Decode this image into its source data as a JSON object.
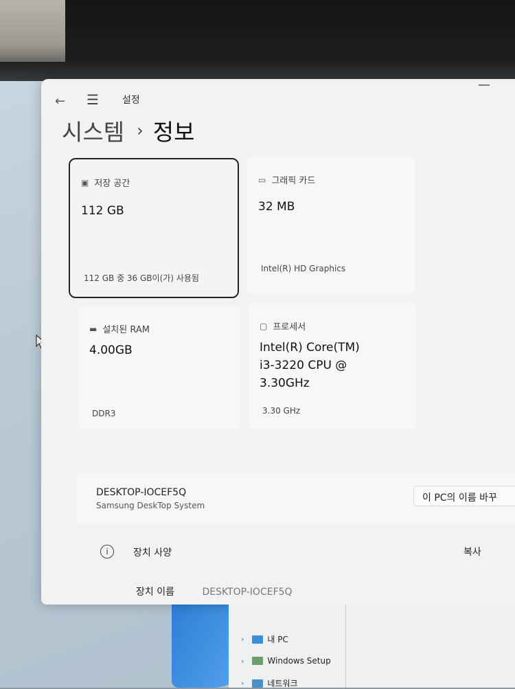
{
  "window": {
    "app_title": "설정",
    "breadcrumb": {
      "parent": "시스템",
      "separator": "›",
      "current": "정보"
    }
  },
  "cards": {
    "storage": {
      "label": "저장 공간",
      "value": "112 GB",
      "detail": "112 GB 중 36 GB이(가) 사용됨",
      "icon": "storage-icon"
    },
    "graphics": {
      "label": "그래픽 카드",
      "value": "32 MB",
      "detail": "Intel(R) HD Graphics",
      "icon": "display-icon"
    },
    "ram": {
      "label": "설치된 RAM",
      "value": "4.00GB",
      "detail": "DDR3",
      "icon": "ram-icon"
    },
    "processor": {
      "label": "프로세서",
      "value_lines": [
        "Intel(R) Core(TM)",
        "i3-3220 CPU @",
        "3.30GHz"
      ],
      "detail": "3.30 GHz",
      "icon": "processor-icon"
    }
  },
  "device": {
    "name": "DESKTOP-IOCEF5Q",
    "model": "Samsung DeskTop System",
    "rename_button": "이 PC의 이름 바꾸"
  },
  "specs": {
    "label": "장치 사양",
    "copy_button": "복사",
    "device_name_label": "장치 이름",
    "device_name_value": "DESKTOP-IOCEF5Q"
  },
  "explorer": {
    "items": [
      {
        "label": "내 PC",
        "icon": "pc-icon"
      },
      {
        "label": "Windows Setup",
        "icon": "setup-icon"
      },
      {
        "label": "네트워크",
        "icon": "network-icon"
      }
    ]
  }
}
